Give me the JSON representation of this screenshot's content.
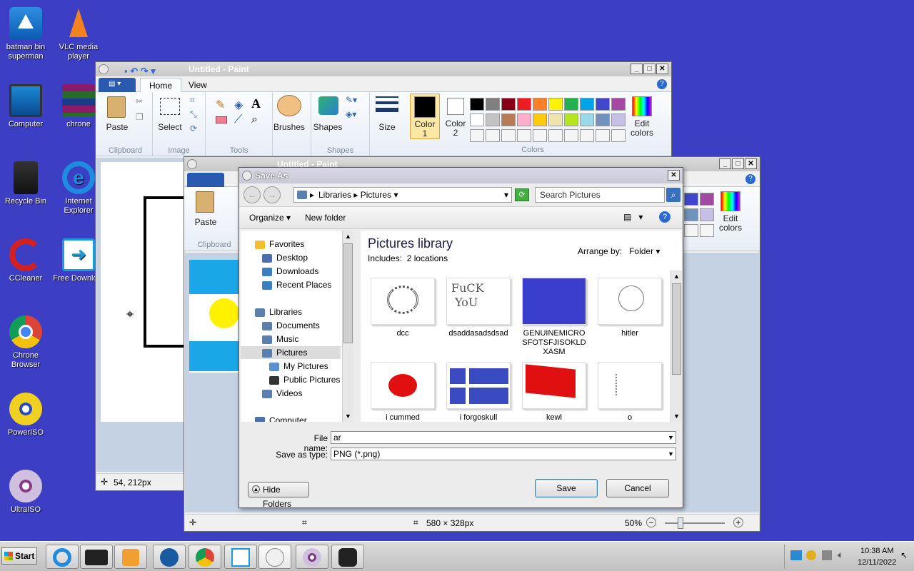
{
  "desktop": {
    "icons": [
      {
        "label": "batman bin superman",
        "icon": "vdesk-icon"
      },
      {
        "label": "VLC media player",
        "icon": "vlc-icon"
      },
      {
        "label": "Computer",
        "icon": "computer-icon"
      },
      {
        "label": "chrone",
        "icon": "winrar-icon"
      },
      {
        "label": "Recycle Bin",
        "icon": "recycle-bin-icon"
      },
      {
        "label": "Internet Explorer",
        "icon": "internet-explorer-icon"
      },
      {
        "label": "CCleaner",
        "icon": "ccleaner-icon"
      },
      {
        "label": "Free Downlo...",
        "icon": "free-download-icon"
      },
      {
        "label": "Chrone Browser",
        "icon": "chrome-icon"
      },
      {
        "label": "PowerISO",
        "icon": "poweriso-icon"
      },
      {
        "label": "UltraISO",
        "icon": "ultraiso-icon"
      }
    ]
  },
  "paint_back": {
    "title": "Untitled - Paint",
    "tabs": [
      "Home",
      "View"
    ],
    "groups": {
      "clipboard": "Clipboard",
      "image": "Image",
      "tools": "Tools",
      "shapes": "Shapes",
      "colors": "Colors"
    },
    "buttons": {
      "paste": "Paste",
      "select": "Select",
      "brushes": "Brushes",
      "shapes": "Shapes",
      "size": "Size",
      "color1": "Color\n1",
      "color1a": "Color",
      "color1b": "1",
      "color2a": "Color",
      "color2b": "2",
      "edit_colors_a": "Edit",
      "edit_colors_b": "colors"
    },
    "status_pos": "54, 212px"
  },
  "paint_front": {
    "title": "Untitled - Paint",
    "paste": "Paste",
    "clipboard": "Clipboard",
    "edit_colors_a": "Edit",
    "edit_colors_b": "colors",
    "status_size": "580 × 328px",
    "zoom": "50%"
  },
  "palette": {
    "row1": [
      "#000000",
      "#7f7f7f",
      "#880015",
      "#ed1c24",
      "#ff7f27",
      "#fff200",
      "#22b14c",
      "#00a2e8",
      "#3f48cc",
      "#a349a4"
    ],
    "row2": [
      "#ffffff",
      "#c3c3c3",
      "#b97a57",
      "#ffaec9",
      "#ffc90e",
      "#efe4b0",
      "#b5e61d",
      "#99d9ea",
      "#7092be",
      "#c8bfe7"
    ]
  },
  "save_dialog": {
    "title": "Save As",
    "breadcrumb": [
      "Libraries",
      "Pictures"
    ],
    "search_placeholder": "Search Pictures",
    "organize": "Organize",
    "new_folder": "New folder",
    "library_title": "Pictures library",
    "includes": "Includes:",
    "locations": "2 locations",
    "arrange_by": "Arrange by:",
    "arrange_value": "Folder",
    "nav": {
      "favorites": "Favorites",
      "desktop": "Desktop",
      "downloads": "Downloads",
      "recent": "Recent Places",
      "libraries": "Libraries",
      "documents": "Documents",
      "music": "Music",
      "pictures": "Pictures",
      "my_pictures": "My Pictures",
      "public_pictures": "Public Pictures",
      "videos": "Videos",
      "computer": "Computer"
    },
    "files": [
      {
        "name": "dcc"
      },
      {
        "name": "dsaddasadsdsad"
      },
      {
        "name": "GENUINEMICROSFOTSFJISOKLDXASM"
      },
      {
        "name": "hitler"
      },
      {
        "name": "i cummed"
      },
      {
        "name": "i forgoskull"
      },
      {
        "name": "kewl"
      },
      {
        "name": "o"
      }
    ],
    "thumb_text": {
      "fuck1": "FuCK",
      "fuck2": "YoU"
    },
    "file_name_label": "File name:",
    "file_name_value": "ar",
    "save_type_label": "Save as type:",
    "save_type_value": "PNG (*.png)",
    "hide_folders": "Hide Folders",
    "save": "Save",
    "cancel": "Cancel"
  },
  "taskbar": {
    "start": "Start",
    "time": "10:38 AM",
    "date": "12/11/2022"
  }
}
